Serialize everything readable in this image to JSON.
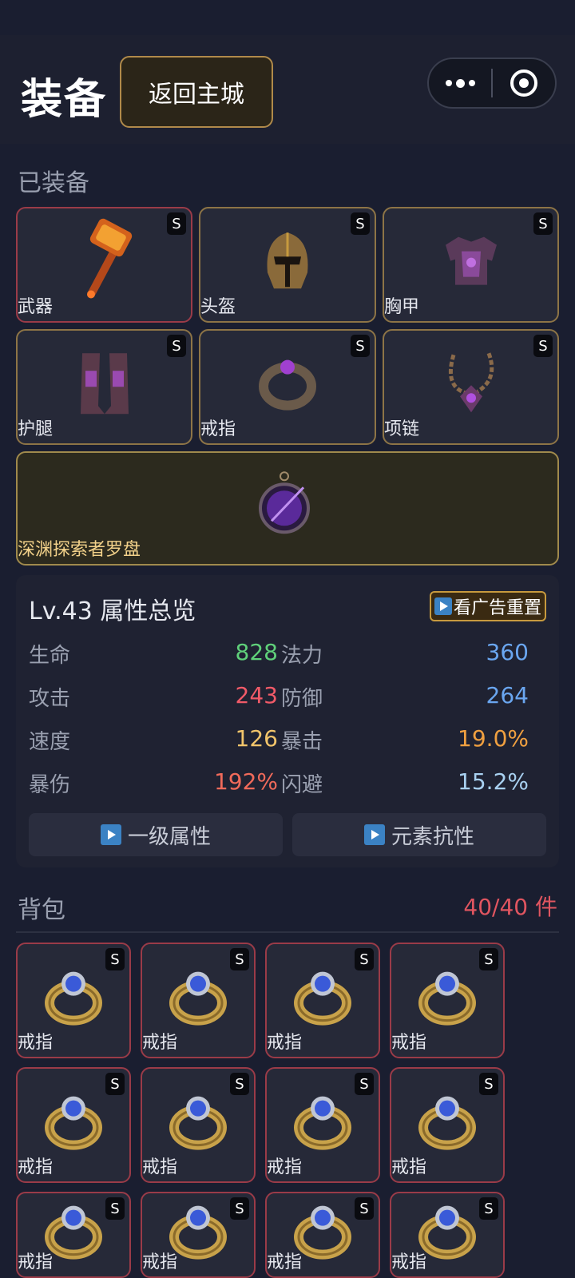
{
  "header": {
    "title": "装备",
    "back_label": "返回主城"
  },
  "equipped": {
    "section_title": "已装备",
    "slots": [
      {
        "label": "武器",
        "grade": "S",
        "icon": "hammer-icon"
      },
      {
        "label": "头盔",
        "grade": "S",
        "icon": "helmet-icon"
      },
      {
        "label": "胸甲",
        "grade": "S",
        "icon": "chest-armor-icon"
      },
      {
        "label": "护腿",
        "grade": "S",
        "icon": "leg-armor-icon"
      },
      {
        "label": "戒指",
        "grade": "S",
        "icon": "ring-icon"
      },
      {
        "label": "项链",
        "grade": "S",
        "icon": "necklace-icon"
      }
    ],
    "special": {
      "label": "深渊探索者罗盘",
      "icon": "compass-icon"
    }
  },
  "stats": {
    "title": "Lv.43 属性总览",
    "ad_reset": "看广告重置",
    "items": [
      {
        "name": "生命",
        "value": "828",
        "color": "#5fd07a"
      },
      {
        "name": "法力",
        "value": "360",
        "color": "#6aa6f0"
      },
      {
        "name": "攻击",
        "value": "243",
        "color": "#f05a68"
      },
      {
        "name": "防御",
        "value": "264",
        "color": "#6aa6f0"
      },
      {
        "name": "速度",
        "value": "126",
        "color": "#f2c56b"
      },
      {
        "name": "暴击",
        "value": "19.0%",
        "color": "#f0a040"
      },
      {
        "name": "暴伤",
        "value": "192%",
        "color": "#f06a5a"
      },
      {
        "name": "闪避",
        "value": "15.2%",
        "color": "#a8d0f0"
      }
    ],
    "primary_btn": "一级属性",
    "element_btn": "元素抗性"
  },
  "bag": {
    "title": "背包",
    "count": "40/40 件",
    "items": [
      {
        "label": "戒指",
        "grade": "S"
      },
      {
        "label": "戒指",
        "grade": "S"
      },
      {
        "label": "戒指",
        "grade": "S"
      },
      {
        "label": "戒指",
        "grade": "S"
      },
      {
        "label": "戒指",
        "grade": "S"
      },
      {
        "label": "戒指",
        "grade": "S"
      },
      {
        "label": "戒指",
        "grade": "S"
      },
      {
        "label": "戒指",
        "grade": "S"
      },
      {
        "label": "戒指",
        "grade": "S"
      },
      {
        "label": "戒指",
        "grade": "S"
      },
      {
        "label": "戒指",
        "grade": "S"
      },
      {
        "label": "戒指",
        "grade": "S"
      }
    ]
  },
  "colors": {
    "accent_gold": "#b08a4a",
    "border_red": "#9a3b48",
    "count_red": "#e05560"
  }
}
